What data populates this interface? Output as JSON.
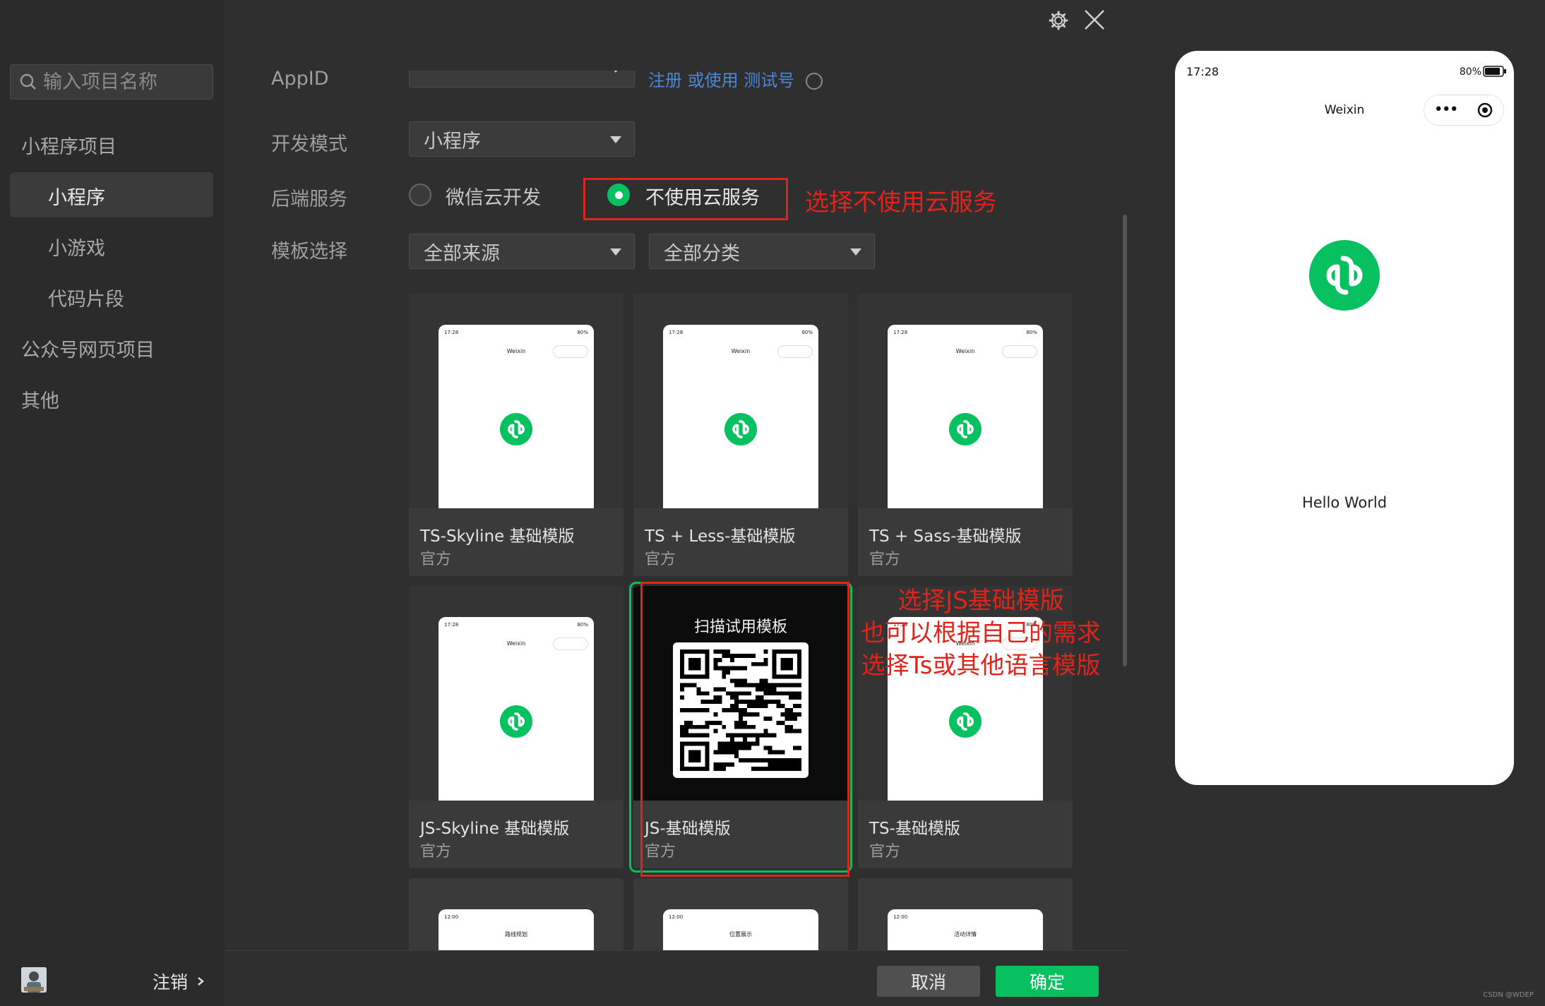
{
  "sidebar": {
    "search": {
      "placeholder": "输入项目名称"
    },
    "nav": [
      {
        "label": "小程序项目"
      },
      {
        "label": "小程序",
        "selected": true
      },
      {
        "label": "小游戏"
      },
      {
        "label": "代码片段"
      },
      {
        "label": "公众号网页项目"
      },
      {
        "label": "其他"
      }
    ],
    "logout_label": "注销"
  },
  "form": {
    "appid_label": "AppID",
    "appid_link": "注册 或使用 测试号",
    "mode_label": "开发模式",
    "mode_value": "小程序",
    "backend_label": "后端服务",
    "backend_options": [
      "微信云开发",
      "不使用云服务"
    ],
    "backend_selected": "不使用云服务",
    "template_label": "模板选择",
    "source_value": "全部来源",
    "category_value": "全部分类"
  },
  "annotations": {
    "cloud": "选择不使用云服务",
    "js_line1": "选择JS基础模版",
    "js_line2": "也可以根据自己的需求",
    "js_line3": "选择Ts或其他语言模版"
  },
  "templates": [
    {
      "title": "TS-Skyline 基础模版",
      "sub": "官方"
    },
    {
      "title": "TS + Less-基础模版",
      "sub": "官方"
    },
    {
      "title": "TS + Sass-基础模版",
      "sub": "官方"
    },
    {
      "title": "JS-Skyline 基础模版",
      "sub": "官方"
    },
    {
      "title": "JS-基础模版",
      "sub": "官方",
      "qr_label": "扫描试用模板",
      "highlighted": true
    },
    {
      "title": "TS-基础模版",
      "sub": "官方"
    }
  ],
  "template_mini": {
    "time": "17:28",
    "battery": "80%",
    "title": "Weixin"
  },
  "partial_templates": [
    {
      "time": "12:00",
      "title": "路线规划"
    },
    {
      "time": "12:00",
      "title": "位置展示"
    },
    {
      "time": "12:00",
      "title": "活动详情"
    }
  ],
  "footer": {
    "cancel": "取消",
    "confirm": "确定"
  },
  "preview": {
    "time": "17:28",
    "battery": "80%",
    "title": "Weixin",
    "hello": "Hello World"
  },
  "watermark": "CSDN @WDEP",
  "colors": {
    "accent": "#07c160",
    "annotation": "#e0241c"
  }
}
